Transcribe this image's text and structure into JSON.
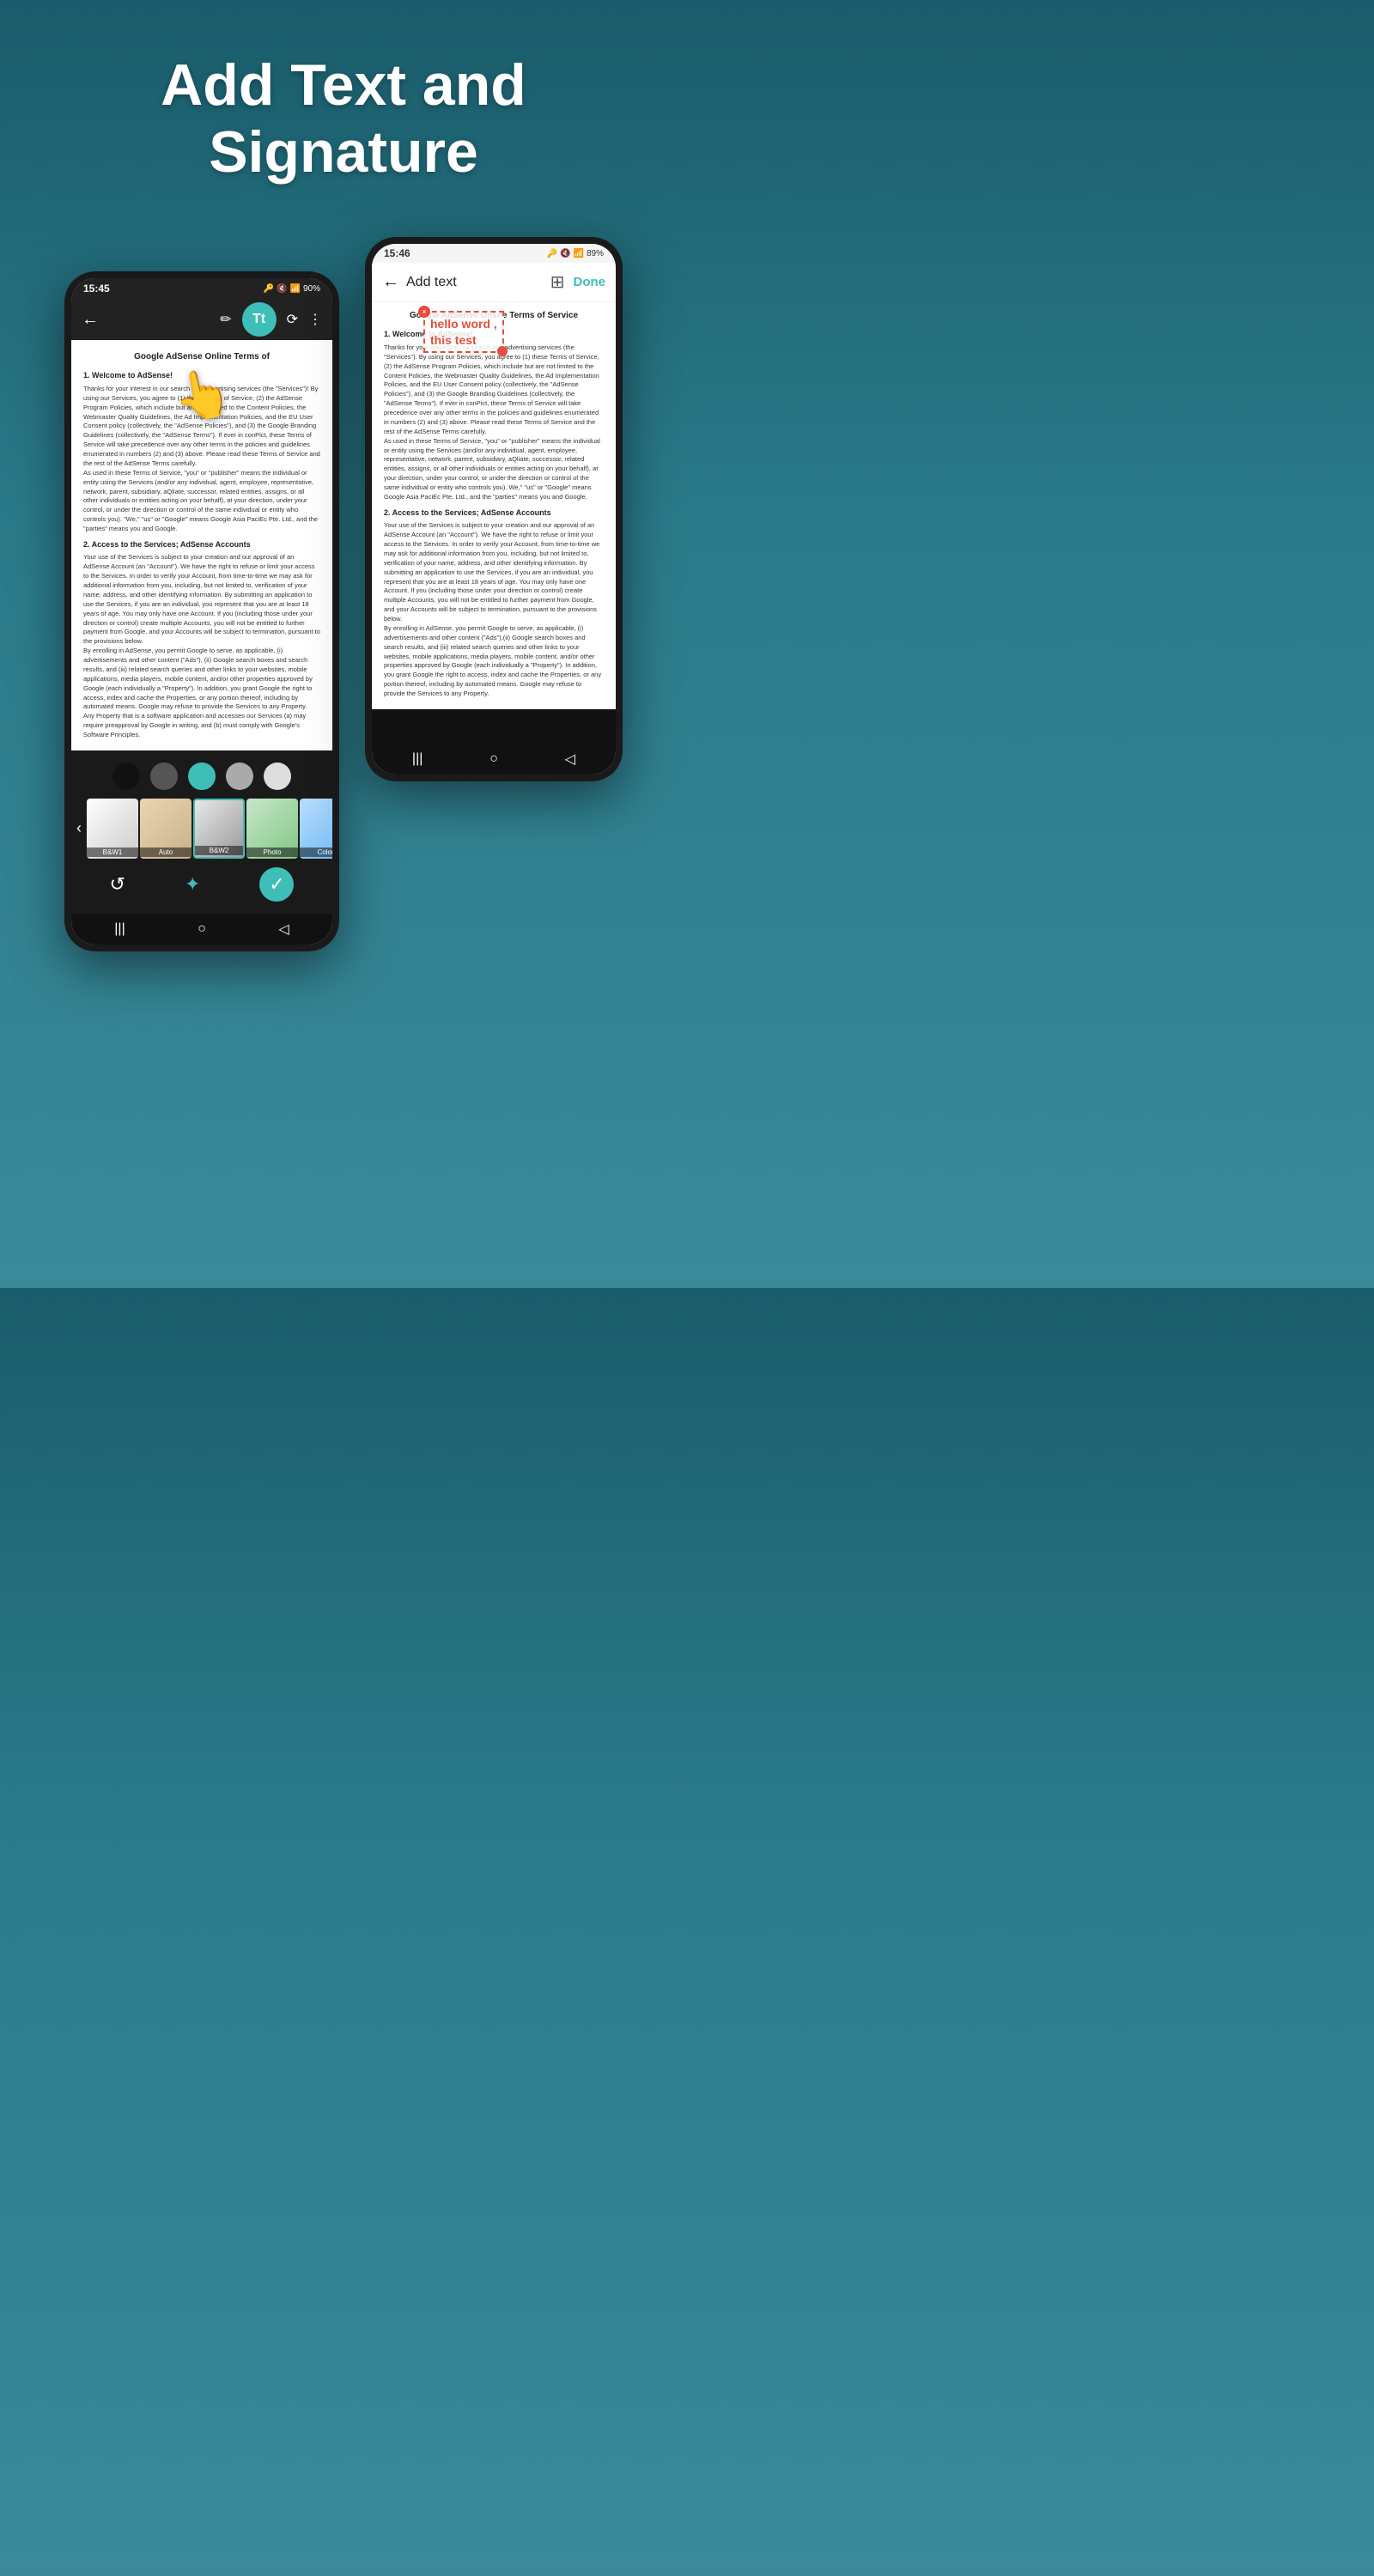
{
  "header": {
    "title": "Add Text and",
    "title2": "Signature"
  },
  "left_phone": {
    "status_bar": {
      "time": "15:45",
      "icons": "🔑🔇📶90%"
    },
    "toolbar": {
      "back_label": "←",
      "tt_label": "Tt",
      "signature_label": "✏",
      "crop_label": "⟳",
      "more_label": "⋮"
    },
    "document": {
      "title": "Google AdSense Online Terms of",
      "section1_title": "1.   Welcome to AdSense!",
      "section1_text": "Thanks for your interest in our search and advertising services (the \"Services\")! By using our Services, you agree to (1) these Terms of Service, (2) the AdSense Program Policies, which include but are not limited to the Content Policies, the Webmaster Quality Guidelines, the Ad Implementation Policies, and the EU User Consent policy (collectively, the \"AdSense Policies\"), and (3) the Google Branding Guidelines (collectively, the \"AdSense Terms\"). If ever in conPict, these Terms of Service will take precedence over any other terms in the policies and guidelines enumerated in numbers (2) and (3) above. Please read these Terms of Service and the rest of the AdSense Terms carefully.",
      "section2_title": "2. Access to the Services; AdSense Accounts",
      "section2_text": "Your use of the Services is subject to your creation and our approval of an AdSense Account (an \"Account\"). We have the right to refuse or limit your access to the Services. In order to verify your Account, from time-to-time we may ask for additional information from you, including, but not limited to, verification of your name, address, and other identifying information. By submitting an application to use the Services, if you are an individual, you represent that you are at least 18 years of age. You may only have one Account. If you (including those under your direction or control) create multiple Accounts, you will not be entitled to further payment from Google, and your Accounts will be subject to termination, pursuant to the provisions below.",
      "section3_text": "By enrolling in AdSense, you permit Google to serve, as applicable, (i) advertisements and other content (\"Ads\"), (ii) Google search boxes and search results, and (iii) related search queries and other links to your websites, mobile applications, media players, mobile content, and/or other properties approved by Google (each individually a \"Property\"). In addition, you grant Google the right to access, index and cache the Properties, or any portion thereof, including by automated means. Google may refuse to provide the Services to any Property.",
      "section4_text": "Any Property that is a software application and accesses our Services (a) may require preapproval by Google in writing, and (b) must comply with Google's Software Principles."
    },
    "filters": {
      "circles": [
        "#1a1a1a",
        "#555",
        "#3dbfb8",
        "#999",
        "#ccc"
      ],
      "thumbnails": [
        {
          "label": "B&W1",
          "active": false
        },
        {
          "label": "Auto",
          "active": false
        },
        {
          "label": "B&W2",
          "active": true
        },
        {
          "label": "Photo",
          "active": false
        },
        {
          "label": "Color",
          "active": false
        }
      ]
    },
    "bottom": {
      "refresh_label": "↺",
      "magic_label": "✦",
      "check_label": "✓"
    },
    "nav": {
      "menu_label": "|||",
      "home_label": "○",
      "back_label": "◁"
    }
  },
  "right_phone": {
    "status_bar": {
      "time": "15:46",
      "icons": "🔑🔇📶89%"
    },
    "toolbar": {
      "back_label": "←",
      "title": "Add text",
      "add_icon": "+",
      "done_label": "Done"
    },
    "text_overlay": {
      "text": "hello word ,\nthis test",
      "close": "×"
    },
    "document": {
      "title": "Google AdSense Online Terms of Service",
      "section1_title": "1.   Welcome to AdSense!",
      "section1_text": "Thanks for your interest in our search and advertising services (the \"Services\"). By using our Services, you agree to (1) these Terms of Service, (2) the AdSense Program Policies, which include but are not limited to the Content Policies, the Webmaster Quality Guidelines, the Ad Implementation Policies, and the EU User Consent policy (collectively, the \"AdSense Policies\"), and (3) the Google Branding Guidelines (collectively, the \"AdSense Terms\"). If ever in conPict, these Terms of Service will take precedence over any other terms in the policies and guidelines enumerated in numbers (2) and (3) above. Please read these Terms of Service and the rest of the AdSense Terms carefully.",
      "section2_text": "As used in these Terms of Service, \"you\" or \"publisher\" means the individual or entity using the Services (and/or any individual, agent, employee, representative, network, parent, subsidiary, aQliate, successor, related entities, assigns, or all other individuals or entities acting on your behalf), at your direction, under your control, or under the direction or control of the same individual or entity who controls you). We,\" \"us\" or \"Google\" means Google Asia PaciEc Pte. Ltd., and the \"parties\" means you and Google.",
      "section3_title": "2. Access to the Services; AdSense Accounts",
      "section3_text": "Your use of the Services is subject to your creation and our approval of an AdSense Account (an \"Account\"). We have the right to refuse or limit your access to the Services. In order to verify your Account, from time-to-time we may ask for additional information from you, including, but not limited to, verification of your name, address, and other identifying information. By submitting an application to use the Services, if you are an individual, you represent that you are at least 18 years of age. You may only have one Account. If you (including those under your direction or control) create multiple Accounts, you will not be entitled to further payment from Google, and your Accounts will be subject to termination, pursuant to the provisions below.",
      "section4_text": "By enrolling in AdSense, you permit Google to serve, as applicable, (i) advertisements and other content (\"Ads\"),(ii) Google search boxes and search results, and (iii) related search queries and other links to your websites, mobile applications, media players, mobile content, and/or other properties approved by Google (each individually a \"Property\"). In addition, you grant Google the right to access, index and cache the Properties, or any portion thereof, including by automated means. Google may refuse to provide the Services to any Property."
    },
    "nav": {
      "menu_label": "|||",
      "home_label": "○",
      "back_label": "◁"
    }
  }
}
